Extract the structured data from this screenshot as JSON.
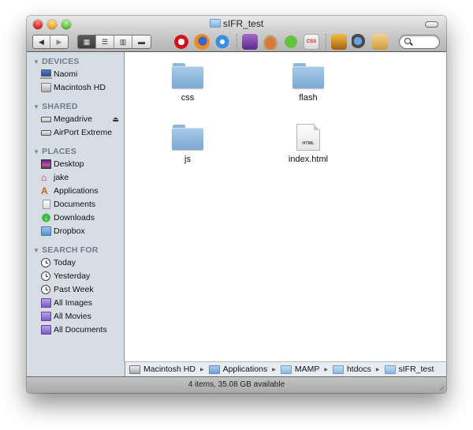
{
  "window": {
    "title": "sIFR_test",
    "title_icon": "folder-icon"
  },
  "toolbar": {
    "nav": [
      {
        "name": "back",
        "glyph": "◀"
      },
      {
        "name": "forward",
        "glyph": "▶"
      }
    ],
    "views": [
      {
        "name": "icon-view",
        "glyph": "▦",
        "active": true
      },
      {
        "name": "list-view",
        "glyph": "☰",
        "active": false
      },
      {
        "name": "column-view",
        "glyph": "▥",
        "active": false
      },
      {
        "name": "coverflow-view",
        "glyph": "▬",
        "active": false
      }
    ],
    "apps": [
      "opera",
      "firefox",
      "safari",
      "photoshop",
      "coffee-cup",
      "leaf",
      "css-edit",
      "pen-tool",
      "preview",
      "documents-folder"
    ],
    "search": {
      "placeholder": "",
      "value": ""
    }
  },
  "sidebar": {
    "sections": [
      {
        "title": "DEVICES",
        "items": [
          {
            "label": "Naomi",
            "icon": "laptop-icon"
          },
          {
            "label": "Macintosh HD",
            "icon": "hard-drive-icon"
          }
        ]
      },
      {
        "title": "SHARED",
        "items": [
          {
            "label": "Megadrive",
            "icon": "network-drive-icon",
            "eject": true
          },
          {
            "label": "AirPort Extreme",
            "icon": "network-drive-icon"
          }
        ]
      },
      {
        "title": "PLACES",
        "items": [
          {
            "label": "Desktop",
            "icon": "desktop-icon"
          },
          {
            "label": "jake",
            "icon": "home-icon"
          },
          {
            "label": "Applications",
            "icon": "applications-icon"
          },
          {
            "label": "Documents",
            "icon": "documents-icon"
          },
          {
            "label": "Downloads",
            "icon": "downloads-icon"
          },
          {
            "label": "Dropbox",
            "icon": "dropbox-icon"
          }
        ]
      },
      {
        "title": "SEARCH FOR",
        "items": [
          {
            "label": "Today",
            "icon": "clock-icon"
          },
          {
            "label": "Yesterday",
            "icon": "clock-icon"
          },
          {
            "label": "Past Week",
            "icon": "clock-icon"
          },
          {
            "label": "All Images",
            "icon": "smart-folder-icon"
          },
          {
            "label": "All Movies",
            "icon": "smart-folder-icon"
          },
          {
            "label": "All Documents",
            "icon": "smart-folder-icon"
          }
        ]
      }
    ],
    "eject_glyph": "⏏",
    "triangle_glyph": "▼"
  },
  "files": [
    {
      "name": "css",
      "kind": "folder"
    },
    {
      "name": "flash",
      "kind": "folder"
    },
    {
      "name": "js",
      "kind": "folder"
    },
    {
      "name": "index.html",
      "kind": "html",
      "badge": "HTML"
    }
  ],
  "pathbar": {
    "crumbs": [
      {
        "label": "Macintosh HD",
        "icon": "hard-drive"
      },
      {
        "label": "Applications",
        "icon": "applications-folder"
      },
      {
        "label": "MAMP",
        "icon": "folder"
      },
      {
        "label": "htdocs",
        "icon": "folder"
      },
      {
        "label": "sIFR_test",
        "icon": "folder"
      }
    ],
    "separator": "▶"
  },
  "status": {
    "text": "4 items, 35.08 GB available"
  }
}
